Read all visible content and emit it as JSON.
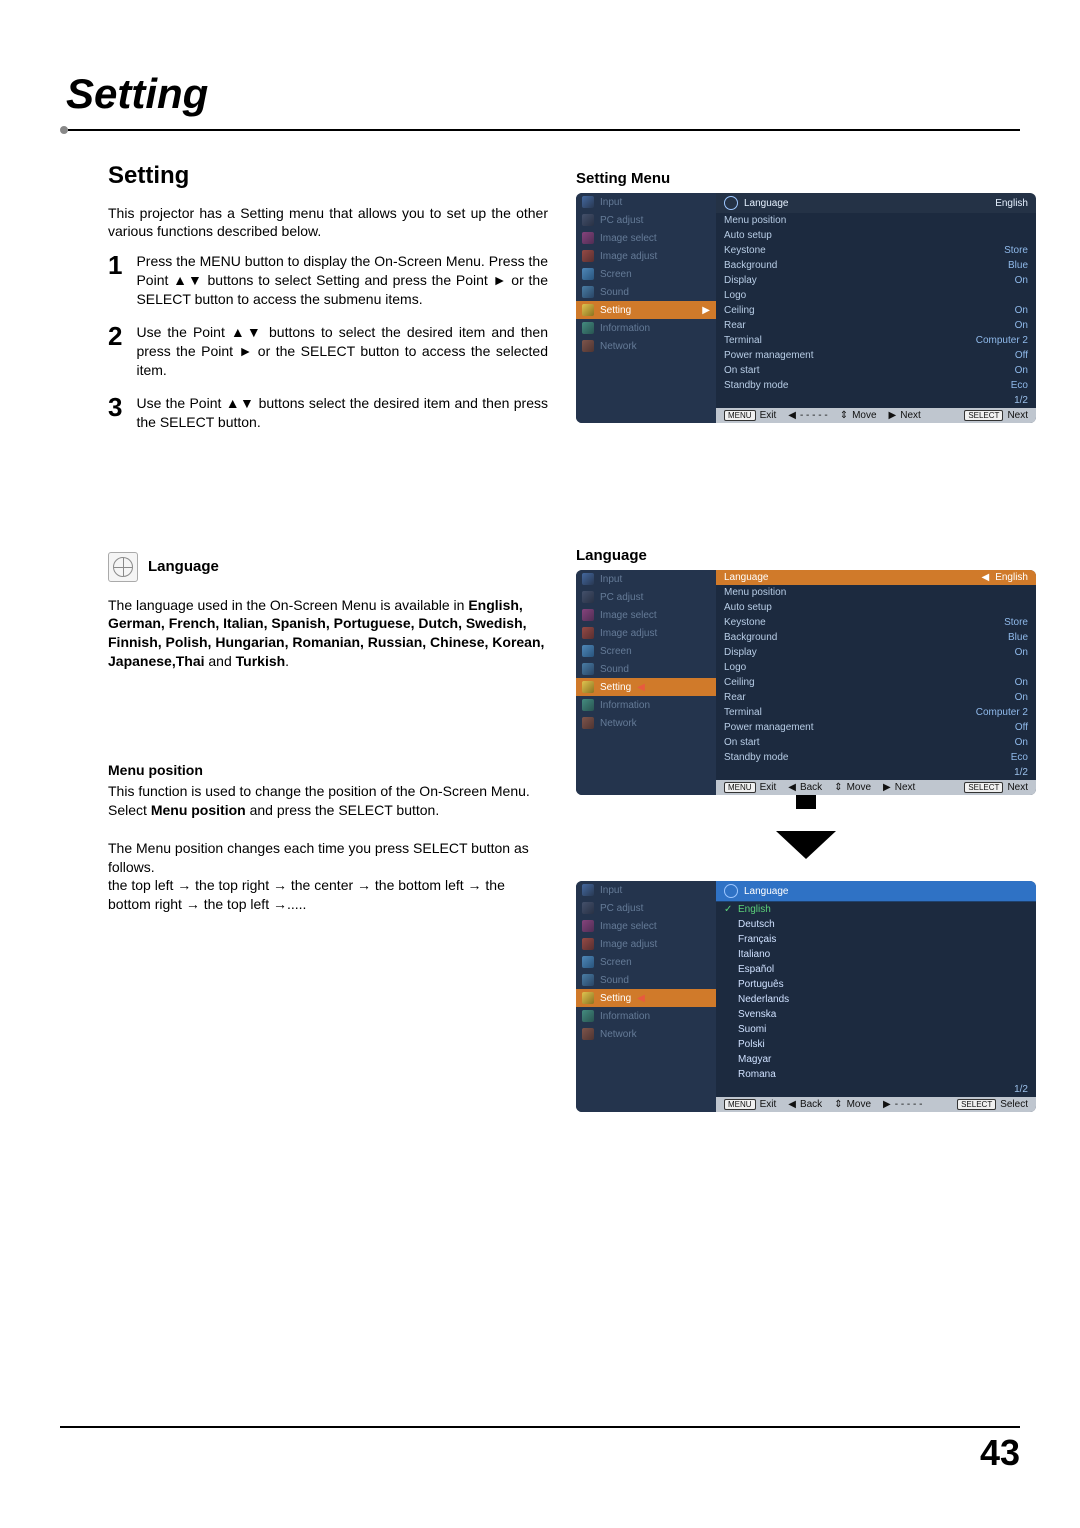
{
  "page": {
    "main_title": "Setting",
    "page_number": "43"
  },
  "left": {
    "section_title": "Setting",
    "intro": "This projector has a Setting menu that allows you to set up the other various functions described below.",
    "steps": [
      "Press the MENU button to display the On-Screen Menu. Press the Point ▲▼ buttons to select Setting and press the Point ► or the SELECT button to access the submenu items.",
      "Use the Point ▲▼ buttons to select the desired item and then press the Point ► or the SELECT button to access the selected item.",
      "Use the Point ▲▼ buttons select the desired item and then press the SELECT button."
    ],
    "lang_heading": "Language",
    "lang_para_pre": "The language used in the On-Screen Menu is available in ",
    "lang_list_bold": "English, German, French, Italian, Spanish, Portuguese, Dutch, Swedish, Finnish, Polish, Hungarian, Romanian, Russian, Chinese, Korean, Japanese,Thai",
    "lang_and": " and ",
    "lang_last": "Turkish",
    "menu_pos": {
      "title": "Menu position",
      "p1a": "This function is used to change the position of the On-Screen Menu. Select ",
      "p1b_bold": "Menu position",
      "p1c": " and press the SELECT button.",
      "p2": "The Menu position changes each time you press SELECT button as follows.",
      "p3": "the top left  →  the top right  →  the center  →  the bottom left  →  the bottom right  →  the top left  →....."
    }
  },
  "right": {
    "heading_setting_menu": "Setting Menu",
    "heading_language": "Language"
  },
  "nav_items": [
    {
      "key": "input",
      "label": "Input",
      "ico": "ico-input"
    },
    {
      "key": "pc",
      "label": "PC adjust",
      "ico": "ico-pc"
    },
    {
      "key": "imsel",
      "label": "Image select",
      "ico": "ico-imsel"
    },
    {
      "key": "imadj",
      "label": "Image adjust",
      "ico": "ico-imadj"
    },
    {
      "key": "screen",
      "label": "Screen",
      "ico": "ico-screen"
    },
    {
      "key": "sound",
      "label": "Sound",
      "ico": "ico-sound"
    },
    {
      "key": "setting",
      "label": "Setting",
      "ico": "ico-setting"
    },
    {
      "key": "info",
      "label": "Information",
      "ico": "ico-info"
    },
    {
      "key": "network",
      "label": "Network",
      "ico": "ico-network"
    }
  ],
  "setting_rows": [
    {
      "lbl": "Language",
      "val": "English",
      "header": true
    },
    {
      "lbl": "Menu position",
      "val": ""
    },
    {
      "lbl": "Auto setup",
      "val": ""
    },
    {
      "lbl": "Keystone",
      "val": "Store"
    },
    {
      "lbl": "Background",
      "val": "Blue"
    },
    {
      "lbl": "Display",
      "val": "On"
    },
    {
      "lbl": "Logo",
      "val": ""
    },
    {
      "lbl": "Ceiling",
      "val": "On"
    },
    {
      "lbl": "Rear",
      "val": "On"
    },
    {
      "lbl": "Terminal",
      "val": "Computer 2"
    },
    {
      "lbl": "Power management",
      "val": "Off"
    },
    {
      "lbl": "On start",
      "val": "On"
    },
    {
      "lbl": "Standby mode",
      "val": "Eco"
    }
  ],
  "page_indicator": "1/2",
  "footer": {
    "menu_badge": "MENU",
    "select_badge": "SELECT",
    "exit": "Exit",
    "back": "Back",
    "move": "Move",
    "next": "Next",
    "select": "Select",
    "dashes": "- - - - -",
    "arrow_updown": "⇕",
    "arrow_left": "◀",
    "arrow_right": "▶"
  },
  "lang_options": [
    "English",
    "Deutsch",
    "Français",
    "Italiano",
    "Español",
    "Português",
    "Nederlands",
    "Svenska",
    "Suomi",
    "Polski",
    "Magyar",
    "Romana"
  ]
}
